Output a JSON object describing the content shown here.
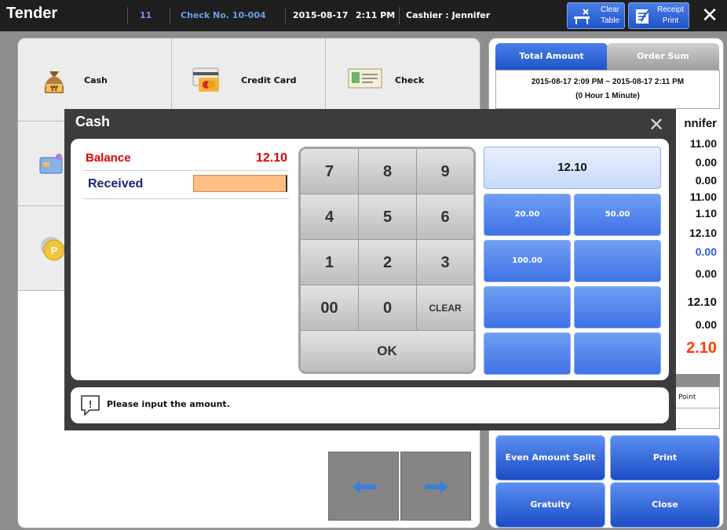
{
  "header": {
    "title": "Tender",
    "table_no": "11",
    "check_no": "Check No. 10-004",
    "date": "2015-08-17",
    "time": "2:11 PM",
    "cashier": "Cashier : Jennifer",
    "clear_table_label": "Clear\nTable",
    "receipt_print_label": "Receipt\nPrint",
    "close_glyph": "✕"
  },
  "tender_types": [
    {
      "label": "Cash",
      "icon": "money-bag-icon"
    },
    {
      "label": "Credit Card",
      "icon": "credit-card-icon"
    },
    {
      "label": "Check",
      "icon": "check-icon"
    }
  ],
  "summary": {
    "tabs": [
      "Total Amount",
      "Order Sum"
    ],
    "period": "2015-08-17 2:09 PM ~ 2015-08-17 2:11 PM",
    "duration": "(0 Hour 1 Minute)",
    "cashier_partial": "nnifer",
    "values": [
      "11.00",
      "0.00",
      "0.00",
      "11.00",
      "1.10",
      "12.10",
      "0.00",
      "0.00",
      "12.10",
      "0.00"
    ],
    "balance_partial": "2.10",
    "point_label": "Point"
  },
  "actions": {
    "even_split": "Even Amount Split",
    "print": "Print",
    "gratuity": "Gratuity",
    "close": "Close"
  },
  "dialog": {
    "title": "Cash",
    "close_glyph": "✕",
    "balance_label": "Balance",
    "balance_value": "12.10",
    "received_label": "Received",
    "received_value": "",
    "keys": [
      "7",
      "8",
      "9",
      "4",
      "5",
      "6",
      "1",
      "2",
      "3",
      "00",
      "0",
      "CLEAR"
    ],
    "ok_label": "OK",
    "quick_amount": "12.10",
    "quick_buttons": [
      "20.00",
      "50.00",
      "100.00",
      "",
      "",
      "",
      "",
      ""
    ],
    "message": "Please input the amount.",
    "message_icon": "!"
  },
  "colors": {
    "balance_red": "#e00000",
    "received_navy": "#1a237e",
    "received_field": "#ffbe85",
    "accent_blue": "#3f72e6"
  }
}
